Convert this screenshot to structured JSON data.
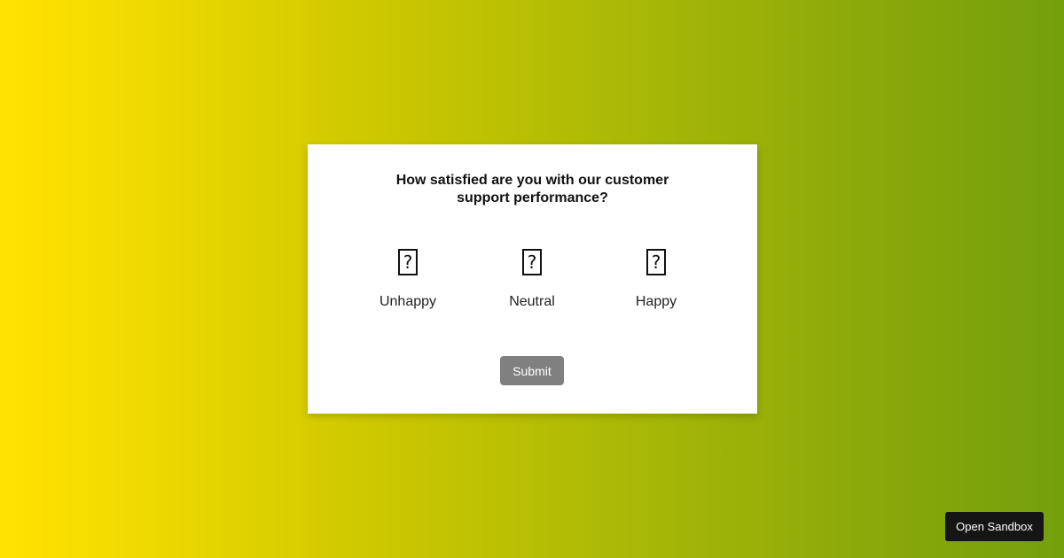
{
  "survey": {
    "question_line1": "How satisfied are you with our customer",
    "question_line2": "support performance?",
    "options": [
      {
        "glyph": "?",
        "label": "Unhappy",
        "icon": "unhappy-face-icon"
      },
      {
        "glyph": "?",
        "label": "Neutral",
        "icon": "neutral-face-icon"
      },
      {
        "glyph": "?",
        "label": "Happy",
        "icon": "happy-face-icon"
      }
    ],
    "submit_label": "Submit"
  },
  "footer": {
    "sandbox_label": "Open Sandbox"
  },
  "colors": {
    "gradient_start": "#ffe300",
    "gradient_end": "#74a00c",
    "card_bg": "#ffffff",
    "submit_bg": "#808080",
    "sandbox_bg": "#151515"
  }
}
